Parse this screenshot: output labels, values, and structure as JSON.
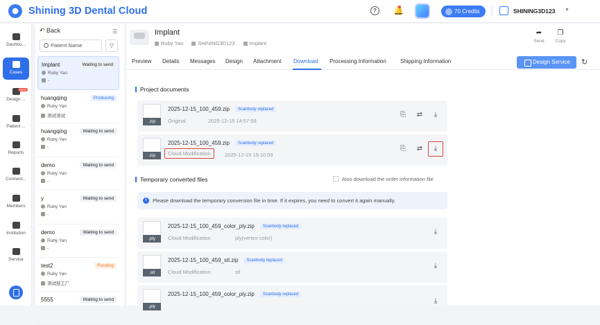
{
  "app": {
    "title": "Shining 3D Dental Cloud",
    "credits": "70 Credits",
    "user": "SHINING3D123"
  },
  "nav": [
    {
      "label": "Dashbo..."
    },
    {
      "label": "Cases"
    },
    {
      "label": "Design ...",
      "badge": "NEW"
    },
    {
      "label": "Patient ..."
    },
    {
      "label": "Reports"
    },
    {
      "label": "Connect..."
    },
    {
      "label": "Members"
    },
    {
      "label": "Institution"
    },
    {
      "label": "Service"
    }
  ],
  "cases_panel": {
    "back": "Back",
    "search_placeholder": "Patient Name"
  },
  "cases": [
    {
      "name": "Implant",
      "status": "Waiting to send",
      "doctor": "Ruby Yan",
      "lab": "-"
    },
    {
      "name": "huangqing",
      "status": "Producing",
      "doctor": "Ruby Yan",
      "lab": "测试测试"
    },
    {
      "name": "huangqing",
      "status": "Waiting to send",
      "doctor": "Ruby Yan",
      "lab": "-"
    },
    {
      "name": "demo",
      "status": "Waiting to send",
      "doctor": "Ruby Yan",
      "lab": "-"
    },
    {
      "name": "y",
      "status": "Waiting to send",
      "doctor": "Ruby Yan",
      "lab": "-"
    },
    {
      "name": "demo",
      "status": "Waiting to send",
      "doctor": "Ruby Yan",
      "lab": "-"
    },
    {
      "name": "test2",
      "status": "Pending",
      "doctor": "Ruby Yan",
      "lab": "测试技工厂"
    },
    {
      "name": "5555",
      "status": "Waiting to send",
      "doctor": "",
      "lab": ""
    }
  ],
  "order": {
    "title": "Implant",
    "doctor": "Ruby Yan",
    "org": "SHINING3D123",
    "type": "Implant"
  },
  "actions": {
    "send": "Send",
    "copy": "Copy"
  },
  "tabs": [
    "Preview",
    "Details",
    "Messages",
    "Design",
    "Attachment",
    "Download",
    "Processing Information",
    "Shipping Information"
  ],
  "design_service": "Design Service",
  "project_docs": {
    "title": "Project documents",
    "files": [
      {
        "ext": ".zip",
        "name": "2025-12-15_100_459.zip",
        "badge": "Scanbody replaced",
        "source": "Original",
        "date": "2025-12-15 14:57:58"
      },
      {
        "ext": ".zip",
        "name": "2025-12-15_100_459.zip",
        "badge": "Scanbody replaced",
        "source": "Cloud Modification",
        "date": "2025-12-15 15:10:09"
      }
    ]
  },
  "temp_files": {
    "title": "Temporary converted files",
    "also_download": "Also download the order information file",
    "notice": "Please download the temporary conversion file in time. If it expires, you need to convert it again manually.",
    "files": [
      {
        "ext": ".ply",
        "name": "2025-12-15_100_459_color_ply.zip",
        "badge": "Scanbody replaced",
        "source": "Cloud Modification",
        "format": "ply(vertex color)"
      },
      {
        "ext": ".stl",
        "name": "2025-12-15_100_459_stl.zip",
        "badge": "Scanbody replaced",
        "source": "Cloud Modification",
        "format": "stl"
      },
      {
        "ext": ".ply",
        "name": "2025-12-15_100_459_color_ply.zip",
        "badge": "Scanbody replaced",
        "source": "",
        "format": ""
      }
    ]
  }
}
